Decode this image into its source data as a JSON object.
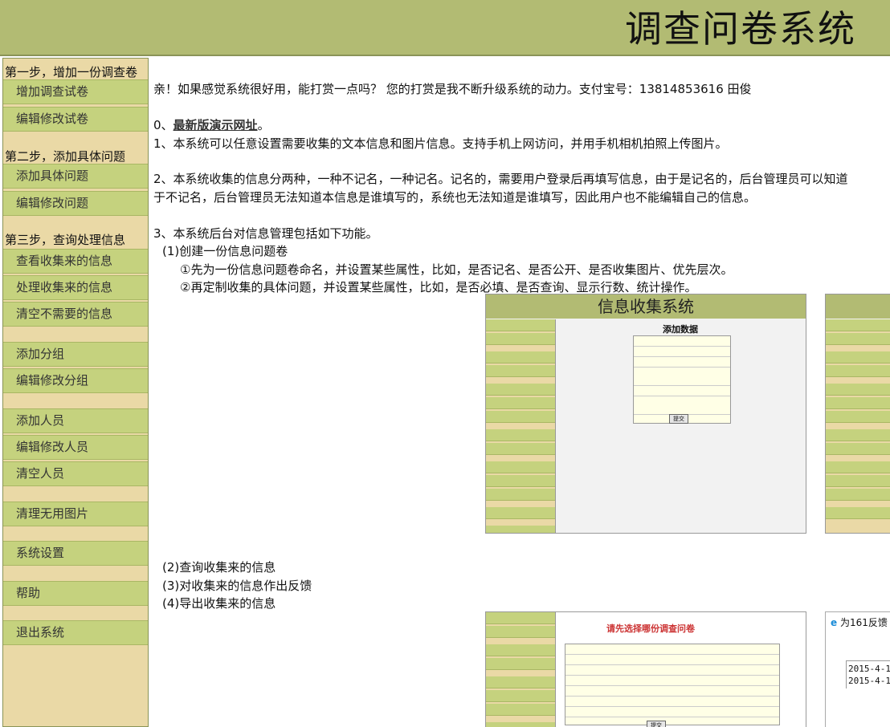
{
  "header": {
    "title": "调查问卷系统"
  },
  "sidebar": {
    "step1": "第一步，增加一份调查卷",
    "step2": "第二步，添加具体问题",
    "step3": "第三步，查询处理信息",
    "items": [
      {
        "label": "增加调查试卷"
      },
      {
        "label": "编辑修改试卷"
      },
      {
        "label": "添加具体问题"
      },
      {
        "label": "编辑修改问题"
      },
      {
        "label": "查看收集来的信息"
      },
      {
        "label": "处理收集来的信息"
      },
      {
        "label": "清空不需要的信息"
      },
      {
        "label": "添加分组"
      },
      {
        "label": "编辑修改分组"
      },
      {
        "label": "添加人员"
      },
      {
        "label": "编辑修改人员"
      },
      {
        "label": "清空人员"
      },
      {
        "label": "清理无用图片"
      },
      {
        "label": "系统设置"
      },
      {
        "label": "帮助"
      },
      {
        "label": "退出系统"
      }
    ]
  },
  "main": {
    "donate": "亲！如果感觉系统很好用，能打赏一点吗？ 您的打赏是我不断升级系统的动力。支付宝号：13814853616 田俊",
    "p0_prefix": "0、",
    "p0_link": "最新版演示网址",
    "p0_suffix": "。",
    "p1": "1、本系统可以任意设置需要收集的文本信息和图片信息。支持手机上网访问，并用手机相机拍照上传图片。",
    "p2a": "2、本系统收集的信息分两种，一种不记名，一种记名。记名的，需要用户登录后再填写信息，由于是记名的，后台管理员可以知道",
    "p2b": "于不记名，后台管理员无法知道本信息是谁填写的，系统也无法知道是谁填写，因此用户也不能编辑自己的信息。",
    "p3": "3、本系统后台对信息管理包括如下功能。",
    "p3_1": "(1)创建一份信息问题卷",
    "p3_1a": "①先为一份信息问题卷命名，并设置某些属性，比如，是否记名、是否公开、是否收集图片、优先层次。",
    "p3_1b": "②再定制收集的具体问题，并设置某些属性，比如，是否必填、是否查询、显示行数、统计操作。",
    "p3_2": "(2)查询收集来的信息",
    "p3_3": "(3)对收集来的信息作出反馈",
    "p3_4": "(4)导出收集来的信息"
  },
  "screenshot1": {
    "header": "信息收集系统",
    "form_title": "添加数据",
    "button": "提交"
  },
  "screenshot3": {
    "red_title": "请先选择哪份调查问卷",
    "button": "提交"
  },
  "screenshot4": {
    "window_title": "为161反馈",
    "lines": [
      "2015-4-1",
      "2015-4-1"
    ]
  }
}
